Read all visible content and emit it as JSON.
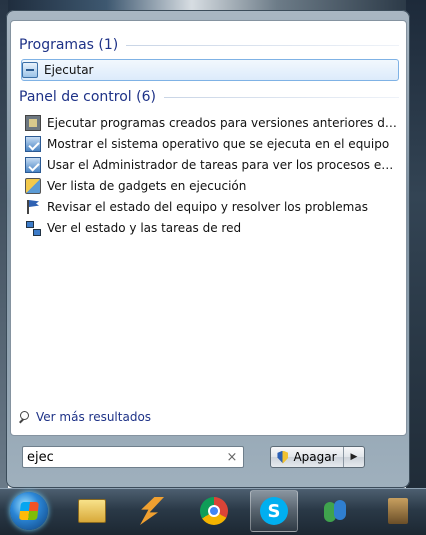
{
  "results": {
    "programs_header": "Programas (1)",
    "programs": [
      {
        "label": "Ejecutar",
        "icon": "run-icon",
        "selected": true
      }
    ],
    "control_panel_header": "Panel de control (6)",
    "control_panel": [
      {
        "label": "Ejecutar programas creados para versiones anteriores de Windo...",
        "icon": "compatibility-icon"
      },
      {
        "label": "Mostrar el sistema operativo que se ejecuta en el equipo",
        "icon": "system-icon"
      },
      {
        "label": "Usar el Administrador de tareas para ver los procesos en ejecuci...",
        "icon": "task-manager-icon"
      },
      {
        "label": "Ver lista de gadgets en ejecución",
        "icon": "gadgets-icon"
      },
      {
        "label": "Revisar el estado del equipo y resolver los problemas",
        "icon": "action-center-flag-icon"
      },
      {
        "label": "Ver el estado y las tareas de red",
        "icon": "network-icon"
      }
    ],
    "more_results": "Ver más resultados"
  },
  "search": {
    "value": "ejec",
    "clear_symbol": "×"
  },
  "shutdown": {
    "label": "Apagar",
    "arrow_symbol": "▶"
  },
  "taskbar": {
    "items": [
      "start-button",
      "windows-explorer",
      "winamp",
      "google-chrome",
      "skype",
      "windows-live-messenger",
      "app"
    ],
    "active": "skype"
  },
  "colors": {
    "header_text": "#1e3287",
    "selection_border": "#7fb2e5",
    "selection_fill": "#dcebfb"
  }
}
